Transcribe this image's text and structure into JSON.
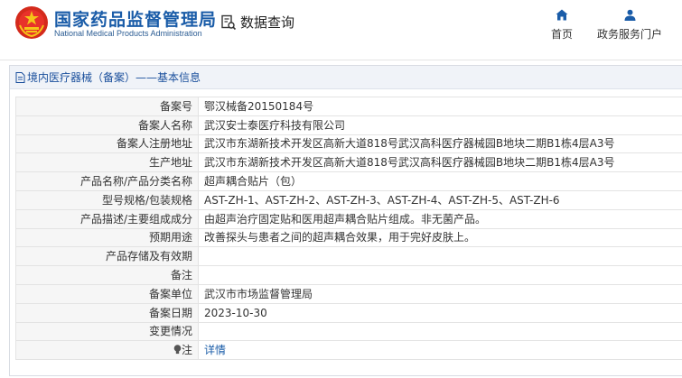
{
  "header": {
    "brand_cn": "国家药品监督管理局",
    "brand_en": "National Medical Products Administration",
    "query_label": "数据查询",
    "nav": [
      {
        "label": "首页",
        "icon": "home-icon"
      },
      {
        "label": "政务服务门户",
        "icon": "user-icon"
      }
    ]
  },
  "panel": {
    "title": "境内医疗器械（备案）——基本信息",
    "title_icon": "document-icon"
  },
  "rows": [
    {
      "label": "备案号",
      "value": "鄂汉械备20150184号"
    },
    {
      "label": "备案人名称",
      "value": "武汉安士泰医疗科技有限公司"
    },
    {
      "label": "备案人注册地址",
      "value": "武汉市东湖新技术开发区高新大道818号武汉高科医疗器械园B地块二期B1栋4层A3号"
    },
    {
      "label": "生产地址",
      "value": "武汉市东湖新技术开发区高新大道818号武汉高科医疗器械园B地块二期B1栋4层A3号"
    },
    {
      "label": "产品名称/产品分类名称",
      "value": "超声耦合贴片（包）"
    },
    {
      "label": "型号规格/包装规格",
      "value": "AST-ZH-1、AST-ZH-2、AST-ZH-3、AST-ZH-4、AST-ZH-5、AST-ZH-6"
    },
    {
      "label": "产品描述/主要组成成分",
      "value": "由超声治疗固定贴和医用超声耦合贴片组成。非无菌产品。"
    },
    {
      "label": "预期用途",
      "value": "改善探头与患者之间的超声耦合效果，用于完好皮肤上。"
    },
    {
      "label": "产品存储及有效期",
      "value": ""
    },
    {
      "label": "备注",
      "value": ""
    },
    {
      "label": "备案单位",
      "value": "武汉市市场监督管理局"
    },
    {
      "label": "备案日期",
      "value": "2023-10-30"
    },
    {
      "label": "变更情况",
      "value": ""
    }
  ],
  "note": {
    "label": "注",
    "link": "详情",
    "icon": "bulb-icon"
  },
  "colors": {
    "brand_blue": "#1a5ca8",
    "title_bg": "#f0f3f8",
    "label_bg": "#f6f6f6"
  }
}
